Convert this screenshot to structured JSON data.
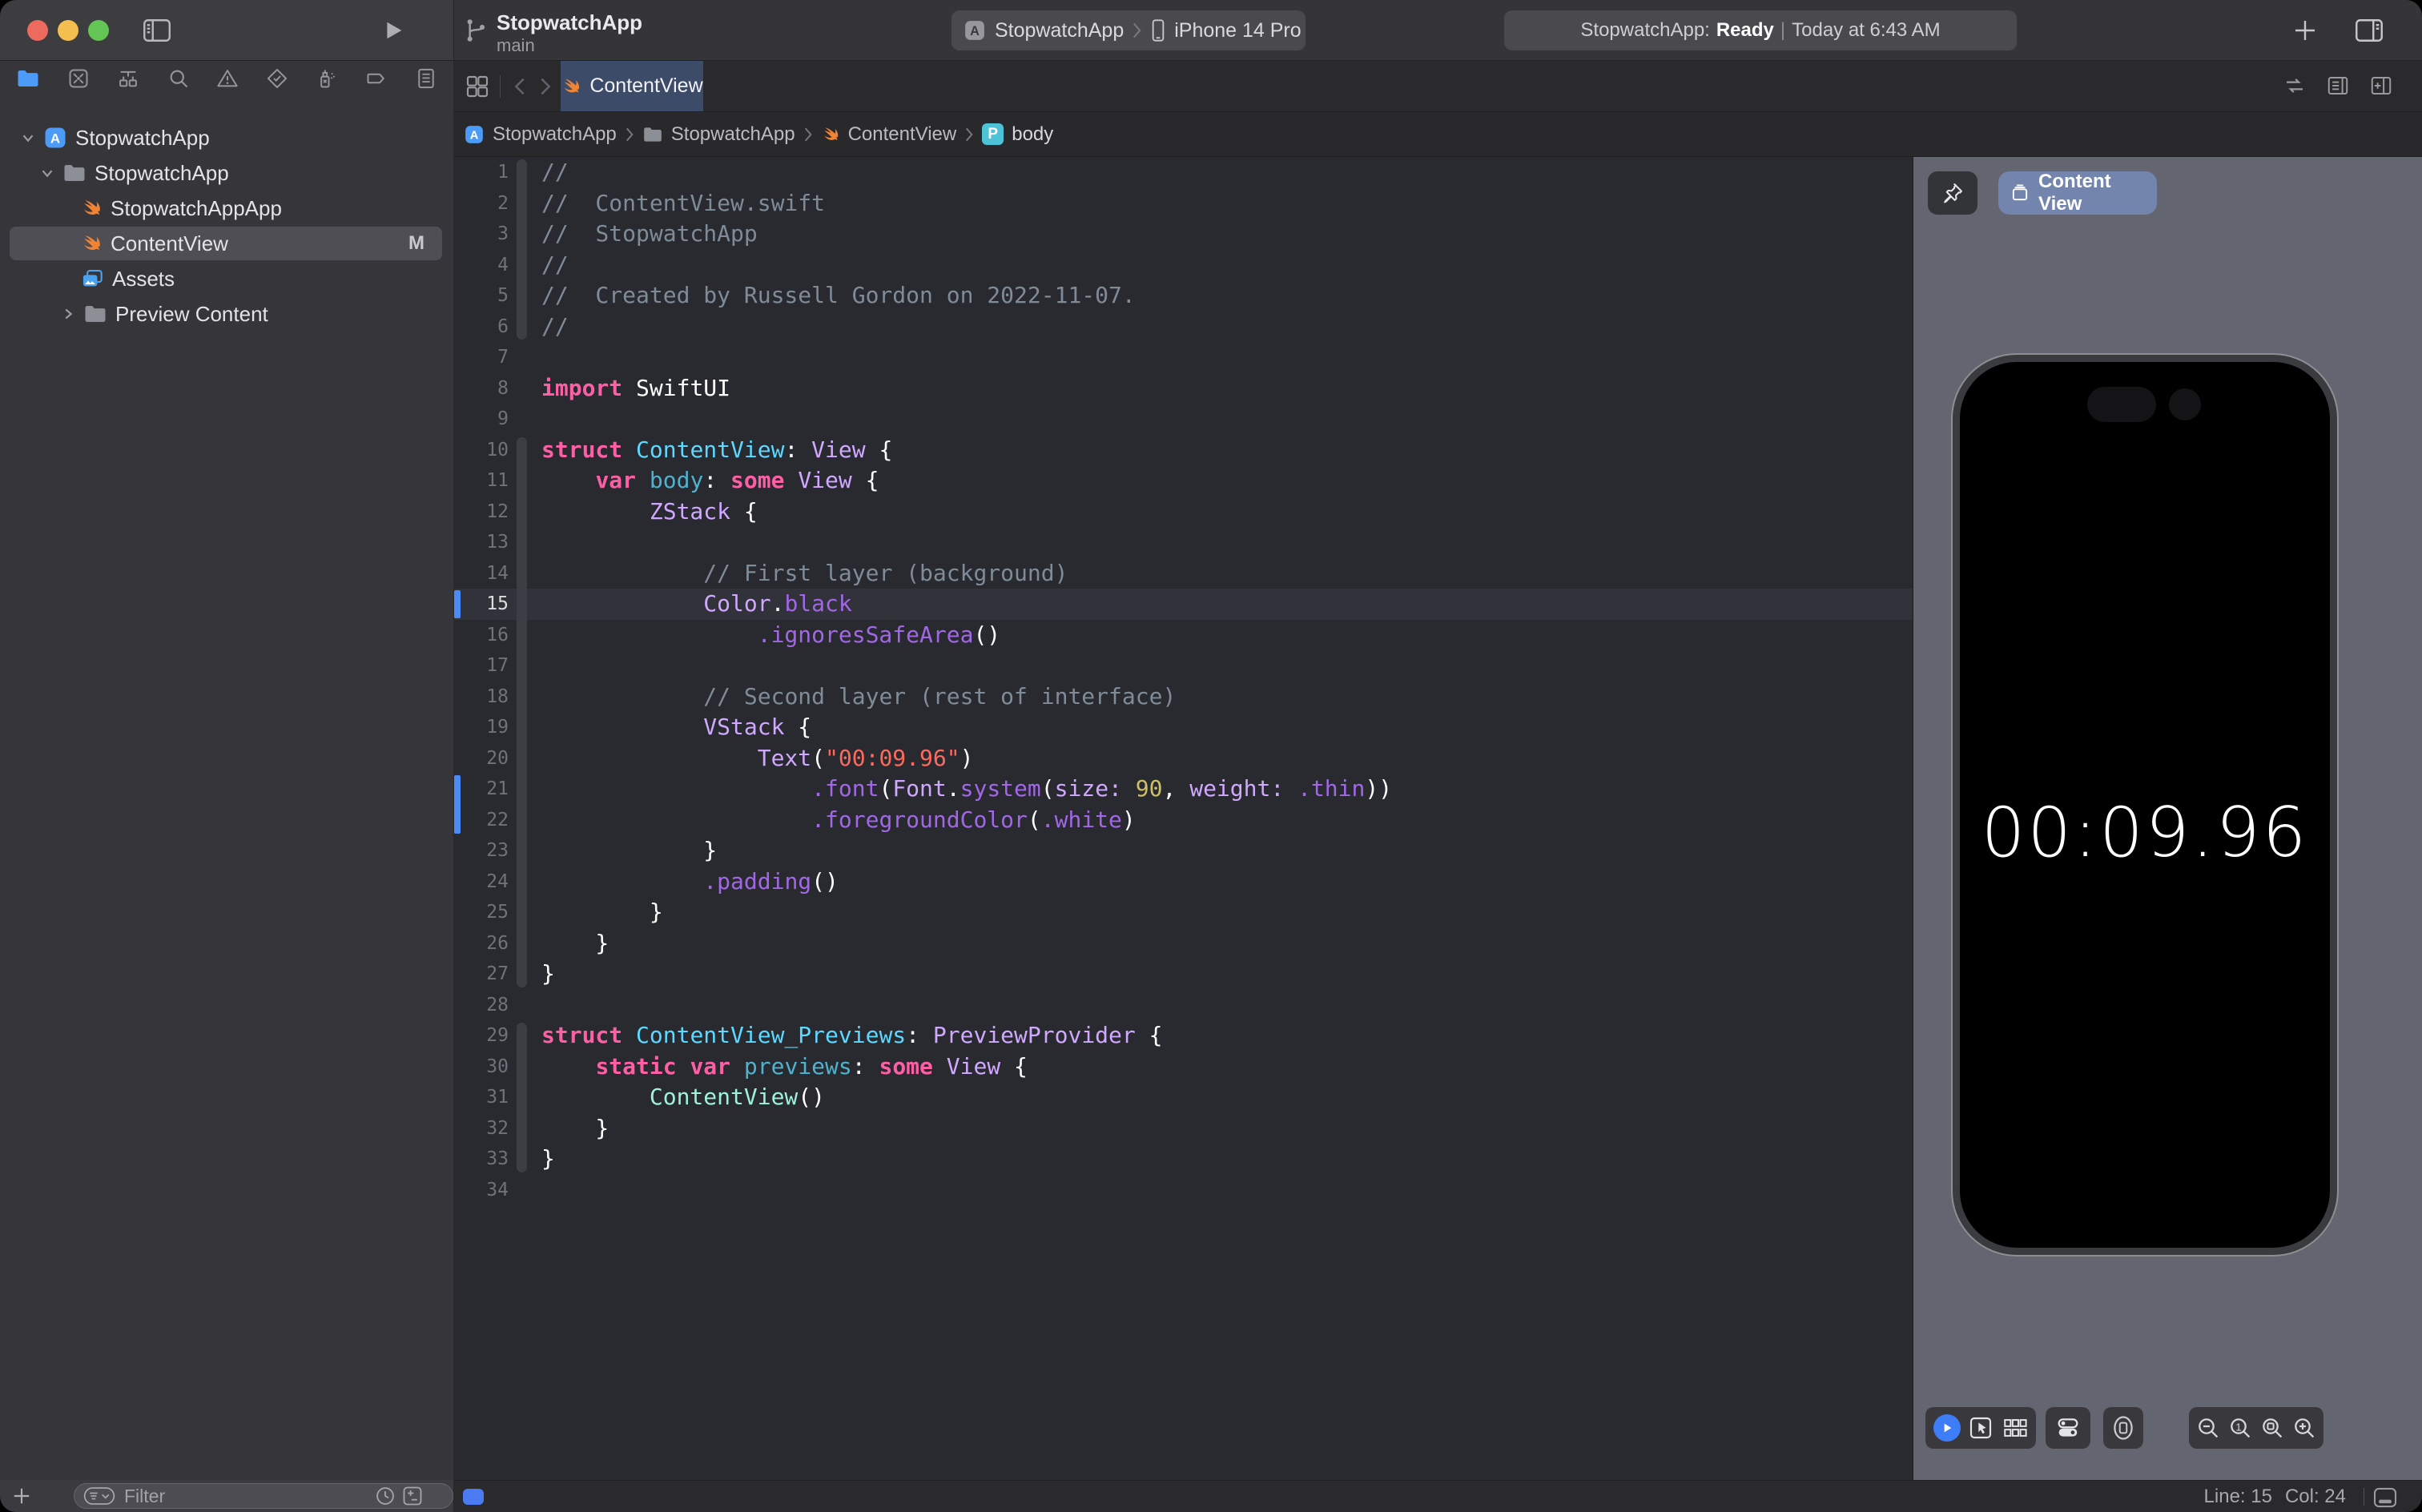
{
  "toolbar": {
    "project_title": "StopwatchApp",
    "branch": "main",
    "scheme_target": "StopwatchApp",
    "run_destination": "iPhone 14 Pro",
    "status_app": "StopwatchApp:",
    "status_state": "Ready",
    "status_separator": "|",
    "status_time": "Today at 6:43 AM"
  },
  "icons": {
    "app_badge_letter": "A",
    "property_badge_letter": "P"
  },
  "navigator": {
    "filter_placeholder": "Filter",
    "files": [
      {
        "name": "StopwatchApp",
        "type": "project",
        "badge": ""
      },
      {
        "name": "StopwatchApp",
        "type": "group",
        "badge": ""
      },
      {
        "name": "StopwatchAppApp",
        "type": "swift-file",
        "badge": ""
      },
      {
        "name": "ContentView",
        "type": "swift-file",
        "badge": "M",
        "selected": true
      },
      {
        "name": "Assets",
        "type": "asset-catalog",
        "badge": ""
      },
      {
        "name": "Preview Content",
        "type": "group",
        "badge": "",
        "collapsed": true
      }
    ]
  },
  "editor": {
    "tab_title": "ContentView",
    "breadcrumbs": [
      "StopwatchApp",
      "StopwatchApp",
      "ContentView",
      "body"
    ],
    "current_line": 15,
    "cursor": {
      "line_label": "Line: 15",
      "col_label": "Col: 24"
    },
    "fold_regions": [
      [
        1,
        6
      ],
      [
        10,
        27
      ],
      [
        29,
        33
      ]
    ],
    "changed_ranges": [
      [
        15,
        15
      ],
      [
        21,
        22
      ]
    ],
    "syntax_colors": {
      "pl": "#FFFFFF",
      "cm": "#7F8C98",
      "kw": "#FC5FA3",
      "ty": "#D0A8FF",
      "td": "#5DD8FF",
      "dc": "#4FB2CE",
      "mt": "#A167E6",
      "st": "#FC6A5D",
      "nm": "#D0BF69",
      "pj": "#9EF1DD"
    },
    "code_lines": [
      [
        [
          "cm",
          "//"
        ]
      ],
      [
        [
          "cm",
          "//  ContentView.swift"
        ]
      ],
      [
        [
          "cm",
          "//  StopwatchApp"
        ]
      ],
      [
        [
          "cm",
          "//"
        ]
      ],
      [
        [
          "cm",
          "//  Created by Russell Gordon on 2022-11-07."
        ]
      ],
      [
        [
          "cm",
          "//"
        ]
      ],
      [],
      [
        [
          "kw",
          "import"
        ],
        [
          "pl",
          " SwiftUI"
        ]
      ],
      [],
      [
        [
          "kw",
          "struct"
        ],
        [
          "pl",
          " "
        ],
        [
          "td",
          "ContentView"
        ],
        [
          "pl",
          ": "
        ],
        [
          "ty",
          "View"
        ],
        [
          "pl",
          " {"
        ]
      ],
      [
        [
          "pl",
          "    "
        ],
        [
          "kw",
          "var"
        ],
        [
          "pl",
          " "
        ],
        [
          "dc",
          "body"
        ],
        [
          "pl",
          ": "
        ],
        [
          "kw",
          "some"
        ],
        [
          "pl",
          " "
        ],
        [
          "ty",
          "View"
        ],
        [
          "pl",
          " {"
        ]
      ],
      [
        [
          "pl",
          "        "
        ],
        [
          "ty",
          "ZStack"
        ],
        [
          "pl",
          " {"
        ]
      ],
      [],
      [
        [
          "pl",
          "            "
        ],
        [
          "cm",
          "// First layer (background)"
        ]
      ],
      [
        [
          "pl",
          "            "
        ],
        [
          "ty",
          "Color"
        ],
        [
          "pl",
          "."
        ],
        [
          "mt",
          "black"
        ]
      ],
      [
        [
          "pl",
          "                "
        ],
        [
          "mt",
          ".ignoresSafeArea"
        ],
        [
          "pl",
          "()"
        ]
      ],
      [],
      [
        [
          "pl",
          "            "
        ],
        [
          "cm",
          "// Second layer (rest of interface)"
        ]
      ],
      [
        [
          "pl",
          "            "
        ],
        [
          "ty",
          "VStack"
        ],
        [
          "pl",
          " {"
        ]
      ],
      [
        [
          "pl",
          "                "
        ],
        [
          "ty",
          "Text"
        ],
        [
          "pl",
          "("
        ],
        [
          "st",
          "\"00:09.96\""
        ],
        [
          "pl",
          ")"
        ]
      ],
      [
        [
          "pl",
          "                    "
        ],
        [
          "mt",
          ".font"
        ],
        [
          "pl",
          "("
        ],
        [
          "ty",
          "Font"
        ],
        [
          "pl",
          "."
        ],
        [
          "mt",
          "system"
        ],
        [
          "pl",
          "("
        ],
        [
          "ty",
          "size:"
        ],
        [
          "pl",
          " "
        ],
        [
          "nm",
          "90"
        ],
        [
          "pl",
          ", "
        ],
        [
          "ty",
          "weight:"
        ],
        [
          "pl",
          " "
        ],
        [
          "mt",
          ".thin"
        ],
        [
          "pl",
          "))"
        ]
      ],
      [
        [
          "pl",
          "                    "
        ],
        [
          "mt",
          ".foregroundColor"
        ],
        [
          "pl",
          "("
        ],
        [
          "mt",
          ".white"
        ],
        [
          "pl",
          ")"
        ]
      ],
      [
        [
          "pl",
          "            }"
        ]
      ],
      [
        [
          "pl",
          "            "
        ],
        [
          "mt",
          ".padding"
        ],
        [
          "pl",
          "()"
        ]
      ],
      [
        [
          "pl",
          "        }"
        ]
      ],
      [
        [
          "pl",
          "    }"
        ]
      ],
      [
        [
          "pl",
          "}"
        ]
      ],
      [],
      [
        [
          "kw",
          "struct"
        ],
        [
          "pl",
          " "
        ],
        [
          "td",
          "ContentView_Previews"
        ],
        [
          "pl",
          ": "
        ],
        [
          "ty",
          "PreviewProvider"
        ],
        [
          "pl",
          " {"
        ]
      ],
      [
        [
          "pl",
          "    "
        ],
        [
          "kw",
          "static"
        ],
        [
          "pl",
          " "
        ],
        [
          "kw",
          "var"
        ],
        [
          "pl",
          " "
        ],
        [
          "dc",
          "previews"
        ],
        [
          "pl",
          ": "
        ],
        [
          "kw",
          "some"
        ],
        [
          "pl",
          " "
        ],
        [
          "ty",
          "View"
        ],
        [
          "pl",
          " {"
        ]
      ],
      [
        [
          "pl",
          "        "
        ],
        [
          "pj",
          "ContentView"
        ],
        [
          "pl",
          "()"
        ]
      ],
      [
        [
          "pl",
          "    }"
        ]
      ],
      [
        [
          "pl",
          "}"
        ]
      ],
      []
    ]
  },
  "preview": {
    "pinned_view_label": "Content View",
    "time_display": "00:09.96"
  }
}
